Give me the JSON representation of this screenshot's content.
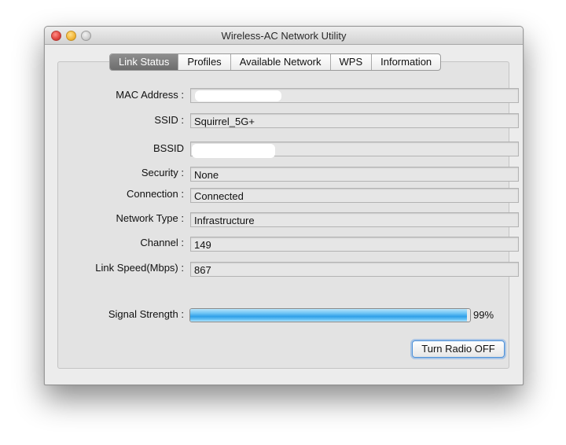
{
  "window": {
    "title": "Wireless-AC Network Utility"
  },
  "tabs": [
    {
      "label": "Link Status"
    },
    {
      "label": "Profiles"
    },
    {
      "label": "Available Network"
    },
    {
      "label": "WPS"
    },
    {
      "label": "Information"
    }
  ],
  "link_status": {
    "mac_address": {
      "label": "MAC Address :",
      "value": ""
    },
    "ssid": {
      "label": "SSID :",
      "value": "Squirrel_5G+"
    },
    "bssid": {
      "label": "BSSID",
      "value": ""
    },
    "security": {
      "label": "Security :",
      "value": "None"
    },
    "connection": {
      "label": "Connection :",
      "value": "Connected"
    },
    "network_type": {
      "label": "Network Type :",
      "value": "Infrastructure"
    },
    "channel": {
      "label": "Channel :",
      "value": "149"
    },
    "link_speed": {
      "label": "Link Speed(Mbps) :",
      "value": "867"
    }
  },
  "signal": {
    "label": "Signal Strength :",
    "percent_text": "99%",
    "level": 0.99
  },
  "buttons": {
    "turn_radio": "Turn Radio OFF"
  },
  "colors": {
    "progress": "#2f9fe8",
    "active_tab": "#7a7a7a",
    "focus_ring": "#4a90d9"
  }
}
